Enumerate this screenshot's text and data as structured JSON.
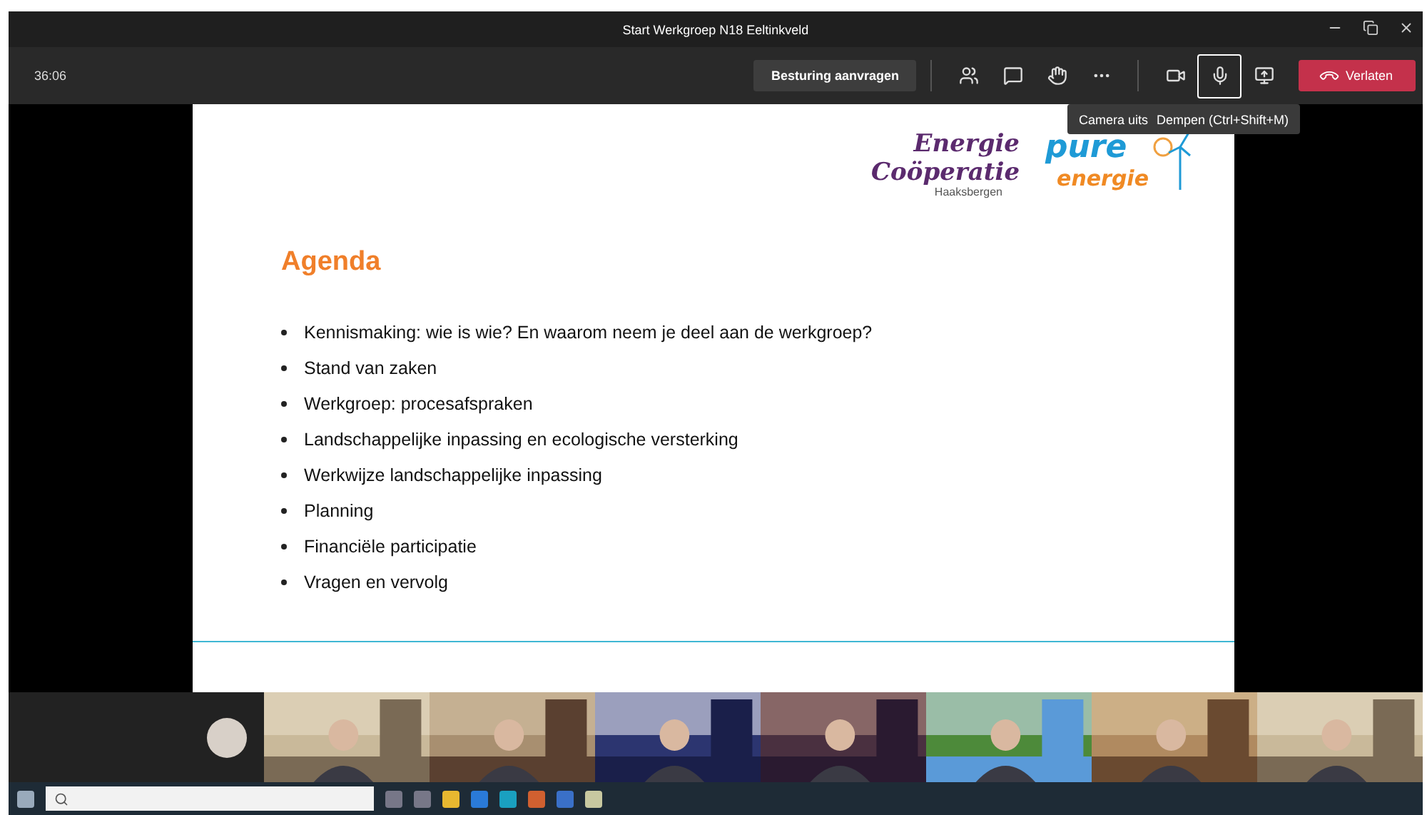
{
  "window": {
    "title": "Start Werkgroep N18 Eeltinkveld"
  },
  "toolbar": {
    "timer": "36:06",
    "request_control": "Besturing aanvragen",
    "controls": [
      {
        "kind": "people",
        "selected": false
      },
      {
        "kind": "chat",
        "selected": false
      },
      {
        "kind": "hand",
        "selected": false
      },
      {
        "kind": "more",
        "selected": false
      }
    ],
    "media_controls": [
      {
        "kind": "camera",
        "selected": false
      },
      {
        "kind": "mic",
        "selected": true
      },
      {
        "kind": "share",
        "selected": false
      }
    ],
    "leave": "Verlaten"
  },
  "tooltip": [
    "Camera uits",
    "Dempen (Ctrl+Shift+M)"
  ],
  "slide": {
    "logo_left": {
      "line1": "Energie",
      "line2": "Coöperatie",
      "line3": "Haaksbergen"
    },
    "logo_right": {
      "line1": "pure",
      "line2": "energie"
    },
    "title": "Agenda",
    "bullets": [
      "Kennismaking: wie is wie? En waarom neem je deel aan de werkgroep?",
      "Stand van zaken",
      "Werkgroep: procesafspraken",
      "Landschappelijke inpassing en ecologische versterking",
      "Werkwijze landschappelijke inpassing",
      "Planning",
      "Financiële participatie",
      "Vragen en vervolg"
    ]
  },
  "participants": [
    {
      "kind": "avatar"
    },
    {
      "kind": "video"
    },
    {
      "kind": "video"
    },
    {
      "kind": "video"
    },
    {
      "kind": "video"
    },
    {
      "kind": "video"
    },
    {
      "kind": "video"
    },
    {
      "kind": "video"
    }
  ]
}
